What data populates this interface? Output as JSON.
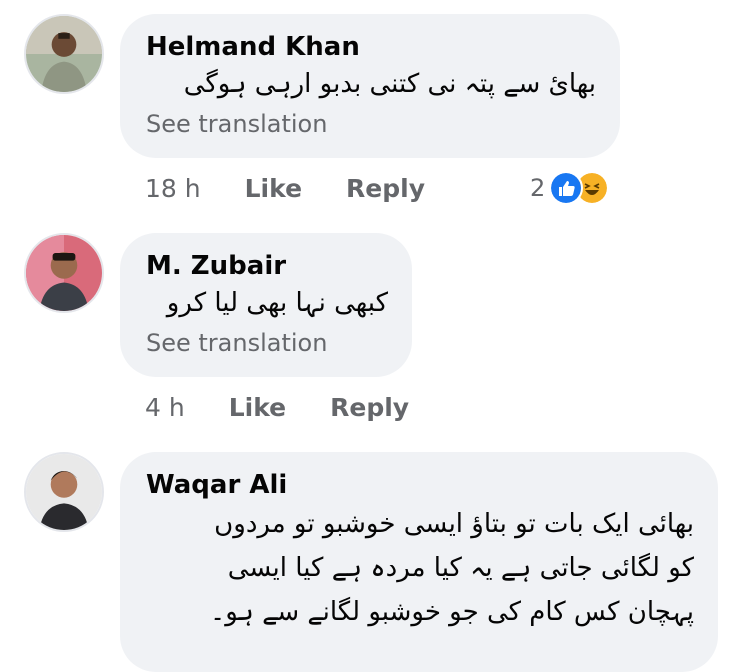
{
  "comments": [
    {
      "author": "Helmand Khan",
      "text": "بھائ سے پتہ نی کتنی بدبو ارہی ہوگی",
      "see_translation": "See translation",
      "time": "18 h",
      "like": "Like",
      "reply": "Reply",
      "reaction_count": "2",
      "reaction_icons": [
        "like-icon",
        "haha-icon"
      ],
      "colors": {
        "like": "#1877f2",
        "haha": "#f7b125"
      }
    },
    {
      "author": "M. Zubair",
      "text": "کبھی نہا بھی لیا کرو",
      "see_translation": "See translation",
      "time": "4 h",
      "like": "Like",
      "reply": "Reply"
    },
    {
      "author": "Waqar Ali",
      "text_lines": [
        "بھائی ایک بات تو بتاؤ ایسی خوشبو تو مردوں",
        "کو لگائی جاتی ہے یہ کیا مردہ ہے کیا ایسی",
        "پہچان کس کام کی جو خوشبو لگانے سے ہو۔"
      ]
    }
  ]
}
